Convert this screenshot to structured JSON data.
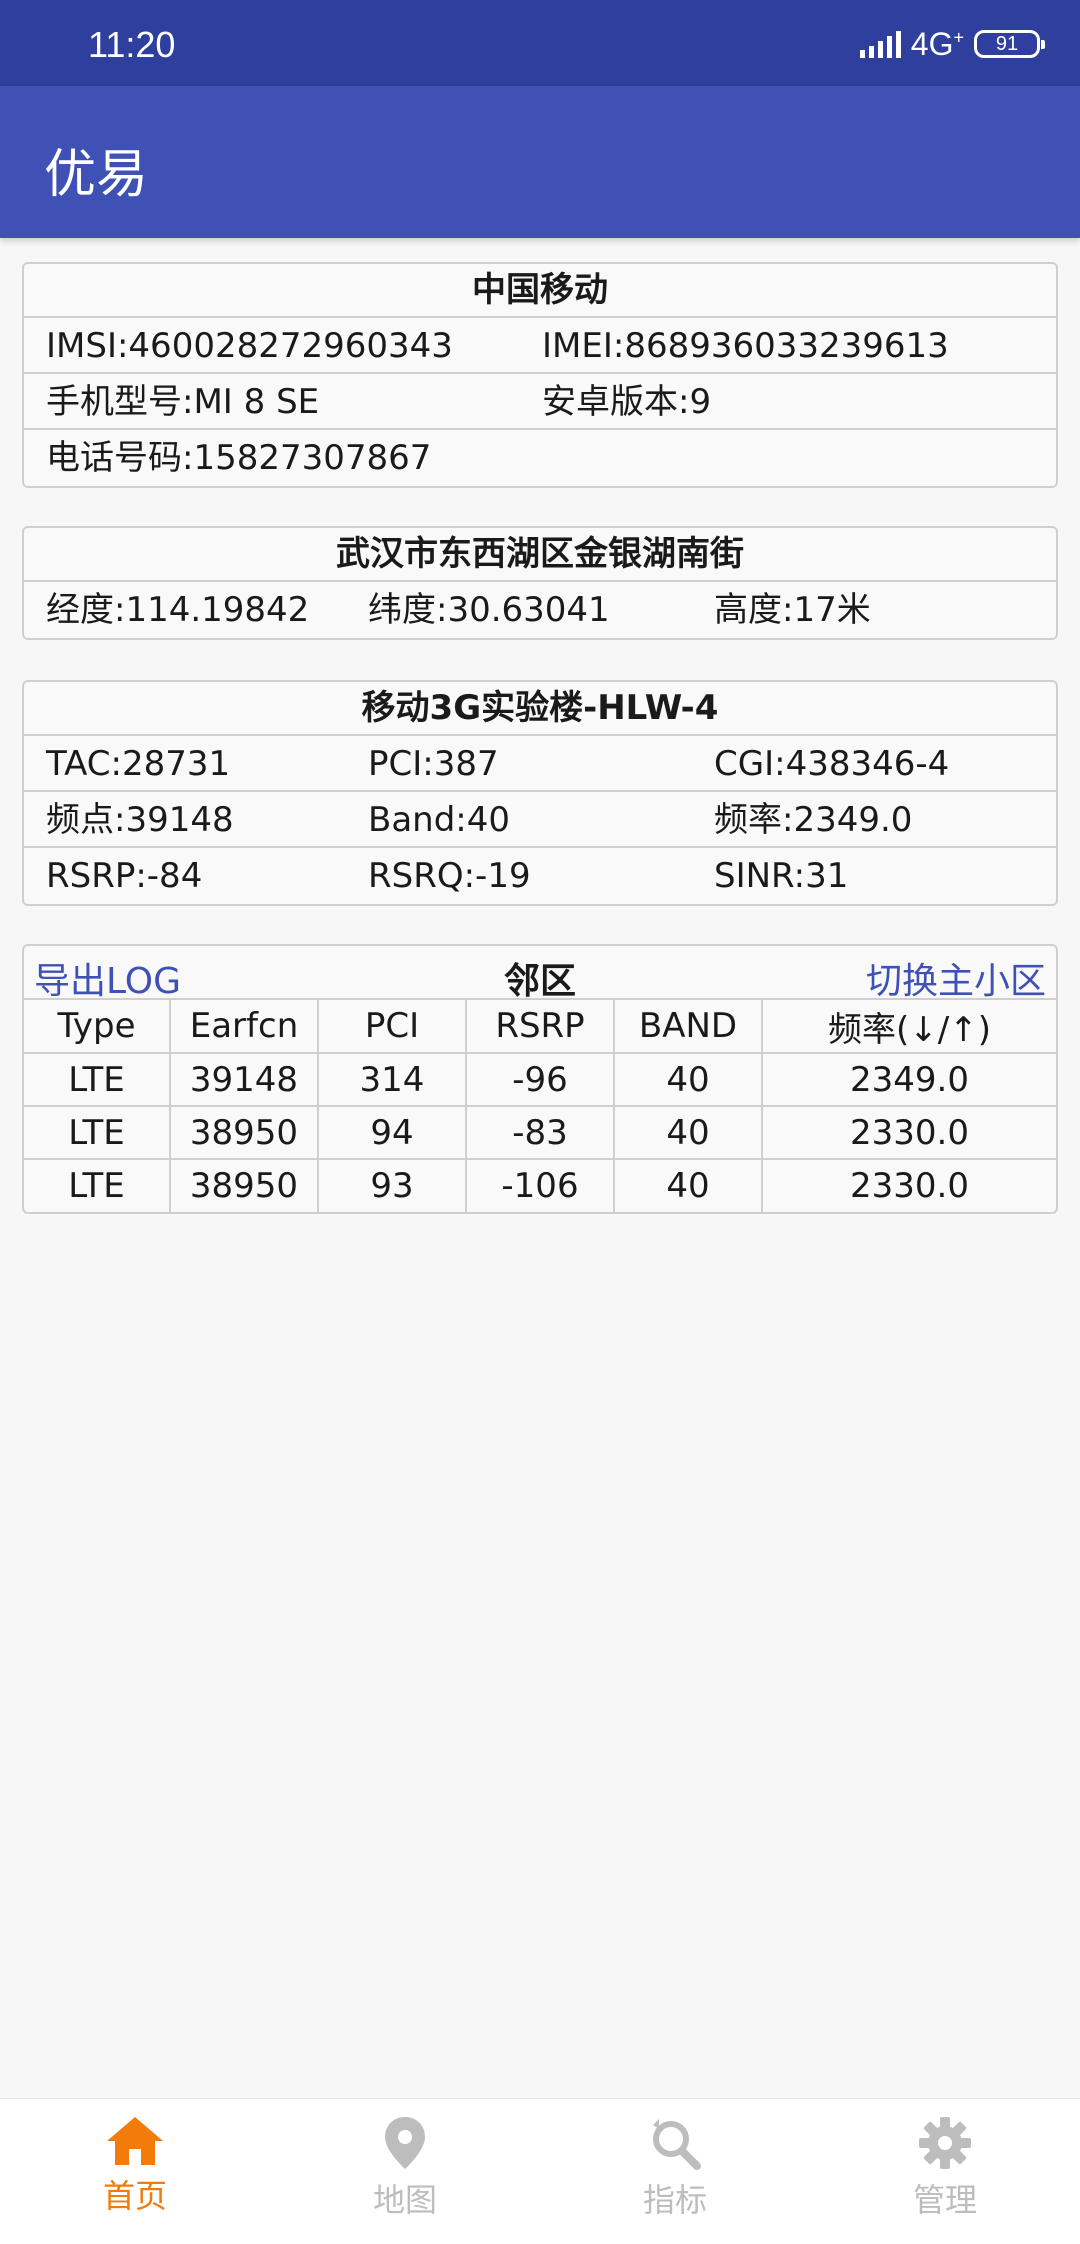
{
  "status": {
    "time": "11:20",
    "network": "4G",
    "network_sup": "+",
    "battery": "91"
  },
  "app": {
    "title": "优易"
  },
  "carrier": {
    "title": "中国移动",
    "imsi": "IMSI:460028272960343",
    "imei": "IMEI:868936033239613",
    "model": "手机型号:MI 8 SE",
    "android": "安卓版本:9",
    "phone": "电话号码:15827307867"
  },
  "location": {
    "title": "武汉市东西湖区金银湖南街",
    "lon": "经度:114.19842",
    "lat": "纬度:30.63041",
    "alt": "高度:17米"
  },
  "cell": {
    "title": "移动3G实验楼-HLW-4",
    "tac": "TAC:28731",
    "pci": "PCI:387",
    "cgi": "CGI:438346-4",
    "earfcn": "频点:39148",
    "band": "Band:40",
    "freq": "频率:2349.0",
    "rsrp": "RSRP:-84",
    "rsrq": "RSRQ:-19",
    "sinr": "SINR:31"
  },
  "neighbors": {
    "export_label": "导出LOG",
    "title": "邻区",
    "switch_label": "切换主小区",
    "columns": [
      "Type",
      "Earfcn",
      "PCI",
      "RSRP",
      "BAND",
      "频率(↓/↑)"
    ],
    "rows": [
      [
        "LTE",
        "39148",
        "314",
        "-96",
        "40",
        "2349.0"
      ],
      [
        "LTE",
        "38950",
        "94",
        "-83",
        "40",
        "2330.0"
      ],
      [
        "LTE",
        "38950",
        "93",
        "-106",
        "40",
        "2330.0"
      ]
    ]
  },
  "nav": {
    "items": [
      {
        "label": "首页",
        "icon": "home-icon",
        "active": true
      },
      {
        "label": "地图",
        "icon": "map-pin-icon",
        "active": false
      },
      {
        "label": "指标",
        "icon": "search-refresh-icon",
        "active": false
      },
      {
        "label": "管理",
        "icon": "gear-icon",
        "active": false
      }
    ]
  },
  "colors": {
    "primary": "#3f51b5",
    "status_bar": "#2f3f9e",
    "active": "#f37b0a",
    "inactive": "#bdbdbd"
  }
}
